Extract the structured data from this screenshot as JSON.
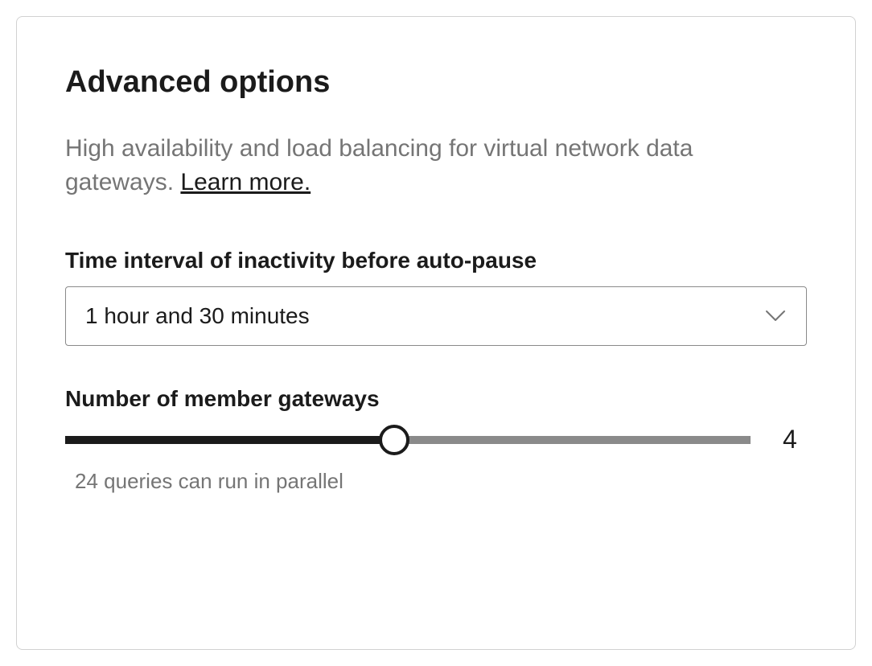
{
  "panel": {
    "title": "Advanced options",
    "description_prefix": "High availability and load balancing for virtual network data gateways. ",
    "learn_more_label": "Learn more."
  },
  "time_interval": {
    "label": "Time interval of inactivity before auto-pause",
    "selected": "1 hour and 30 minutes"
  },
  "member_gateways": {
    "label": "Number of member gateways",
    "value": "4",
    "help_text": "24 queries can run in parallel"
  }
}
